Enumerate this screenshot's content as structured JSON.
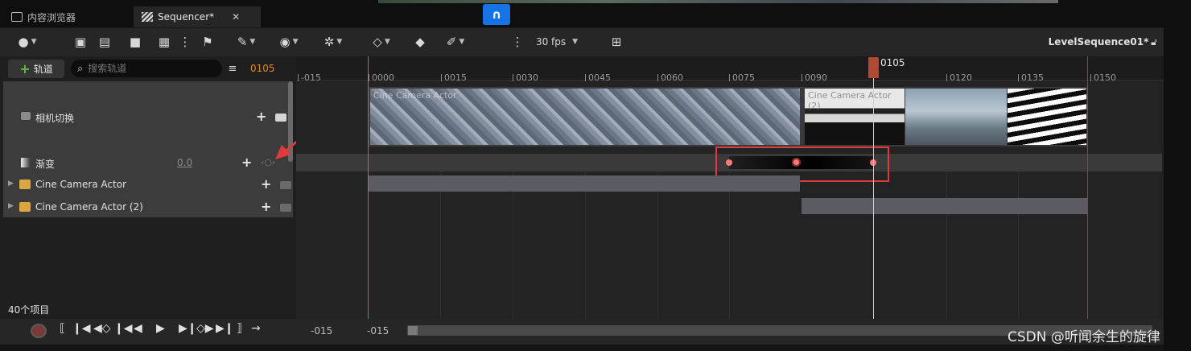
{
  "tabs": [
    {
      "label": "内容浏览器",
      "active": false
    },
    {
      "label": "Sequencer*",
      "active": true,
      "close": "✕"
    }
  ],
  "toolbar": {
    "fps": "30 fps",
    "sequence_name": "LevelSequence01*",
    "icons": [
      "globe-icon",
      "clapper-icon",
      "camera-search-icon",
      "camera-record-icon",
      "film-icon",
      "more-vert-icon",
      "hierarchy-icon",
      "wrench-icon",
      "eye-icon",
      "gear-icon",
      "key-diamond-icon",
      "key-fill-icon",
      "pencil-icon",
      "magnet-snap-icon",
      "more-vert-icon",
      "curve-editor-icon",
      "lock-icon"
    ],
    "accent": "#1673e6"
  },
  "left": {
    "add_track_label": "轨道",
    "search_placeholder": "搜索轨道",
    "current_frame": "0105",
    "tracks": [
      {
        "label": "相机切换",
        "type": "camera-cut"
      },
      {
        "label": "渐变",
        "value": "0.0",
        "type": "fade"
      },
      {
        "label": "Cine Camera Actor",
        "type": "camera-actor"
      },
      {
        "label": "Cine Camera Actor (2)",
        "type": "camera-actor"
      }
    ],
    "item_count": "40个项目"
  },
  "timeline": {
    "ticks": [
      "-015",
      "0000",
      "0015",
      "0030",
      "0045",
      "0060",
      "0075",
      "0090",
      "0105",
      "0120",
      "0135",
      "0150"
    ],
    "playhead_frame": "0105",
    "clips": [
      {
        "label": "Cine Camera Actor"
      },
      {
        "label": "Cine Camera Actor (2)"
      }
    ],
    "view_start": "-015",
    "view_start2": "-015",
    "highlight_color": "#e03b3b",
    "playhead_color": "#b14a30"
  },
  "watermark": "CSDN @听闻余生的旋律"
}
